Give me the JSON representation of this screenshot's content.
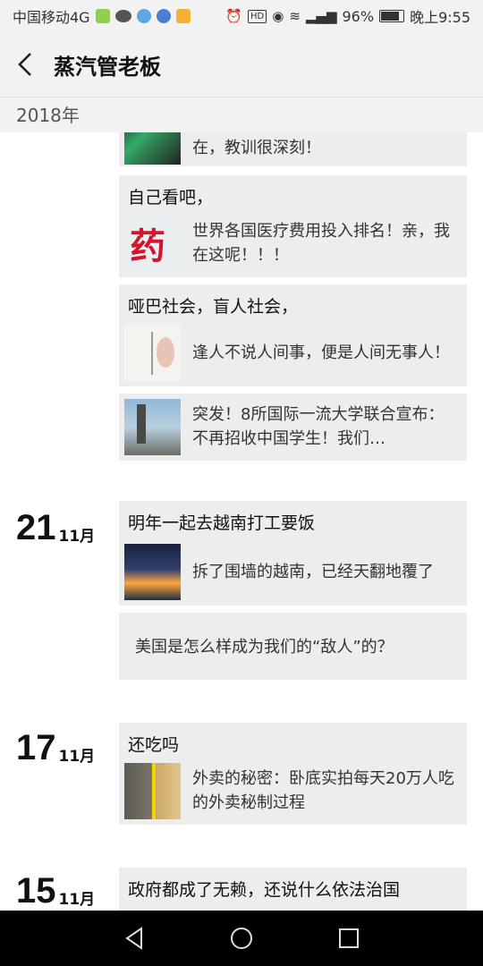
{
  "status_bar": {
    "carrier": "中国移动4G",
    "network": "4G",
    "battery": "96%",
    "time": "晚上9:55",
    "icons": [
      "image-icon",
      "wechat-icon",
      "browser-icon",
      "music-icon",
      "notification-icon",
      "alarm-icon",
      "hd-icon",
      "eye-icon",
      "wifi-icon",
      "signal-icon",
      "battery-icon"
    ]
  },
  "header": {
    "title": "蒸汽管老板",
    "back_icon": "back-arrow-icon"
  },
  "year_label": "2018年",
  "feed": {
    "top_partial": {
      "link_title": "中国网上网友解读的文章，总结很实在，教训很深刻！"
    },
    "posts_nov_unspecified": [
      {
        "text": "自己看吧，",
        "link_title": "世界各国医疗费用投入排名！亲，我在这呢！！！",
        "thumb_text": "药"
      },
      {
        "text": "哑巴社会，盲人社会，",
        "link_title": "逢人不说人间事，便是人间无事人！"
      },
      {
        "text": "",
        "link_title": "突发！8所国际一流大学联合宣布：不再招收中国学生！我们…"
      }
    ],
    "day21": {
      "day": "21",
      "month": "11月",
      "text": "明年一起去越南打工要饭",
      "link_title": "拆了围墙的越南，已经天翻地覆了",
      "plain_link": "美国是怎么样成为我们的“敌人”的？"
    },
    "day17": {
      "day": "17",
      "month": "11月",
      "text": "还吃吗",
      "link_title": "外卖的秘密：卧底实拍每天20万人吃的外卖秘制过程"
    },
    "day15": {
      "day": "15",
      "month": "11月",
      "text": "政府都成了无赖，还说什么依法治国"
    }
  },
  "nav_bar": {
    "buttons": [
      "back-triangle-icon",
      "home-circle-icon",
      "recents-square-icon"
    ]
  }
}
